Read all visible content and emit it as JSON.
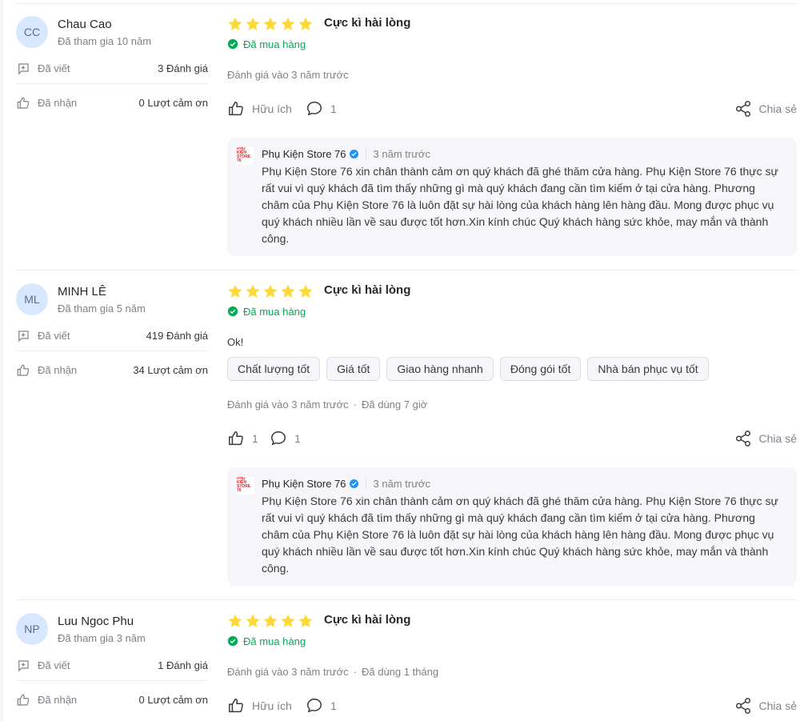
{
  "colors": {
    "star": "#fdd836",
    "bought": "#00ab56",
    "verified": "#1a94ff",
    "reply_bg": "#f5f5fa"
  },
  "reviews": [
    {
      "initials": "CC",
      "name": "Chau Cao",
      "joined": "Đã tham gia 10 năm",
      "written_label": "Đã viết",
      "written_value": "3 Đánh giá",
      "received_label": "Đã nhận",
      "received_value": "0 Lượt cảm ơn",
      "stars": 5,
      "rating_text": "Cực kì hài lòng",
      "bought": "Đã mua hàng",
      "text": "",
      "tags": [],
      "date": "Đánh giá vào 3 năm trước",
      "used": "",
      "like_label": "Hữu ích",
      "comment_count": "1",
      "share_label": "Chia sẻ",
      "reply": {
        "shop": "Phụ Kiện Store 76",
        "time": "3 năm trước",
        "text": "Phụ Kiện Store 76 xin chân thành cảm ơn quý khách đã ghé thăm cửa hàng. Phụ Kiện Store 76 thực sự rất vui vì quý khách đã tìm thấy những gì mà quý khách đang cần tìm kiếm ở tại cửa hàng. Phương châm của Phụ Kiện Store 76 là luôn đặt sự hài lòng của khách hàng lên hàng đầu. Mong được phục vụ quý khách nhiều lần về sau được tốt hơn.Xin kính chúc Quý khách hàng sức khỏe, may mắn và thành công."
      }
    },
    {
      "initials": "ML",
      "name": "MINH LÊ",
      "joined": "Đã tham gia 5 năm",
      "written_label": "Đã viết",
      "written_value": "419 Đánh giá",
      "received_label": "Đã nhận",
      "received_value": "34 Lượt cảm ơn",
      "stars": 5,
      "rating_text": "Cực kì hài lòng",
      "bought": "Đã mua hàng",
      "text": "Ok!",
      "tags": [
        "Chất lượng tốt",
        "Giá tốt",
        "Giao hàng nhanh",
        "Đóng gói tốt",
        "Nhà bán phục vụ tốt"
      ],
      "date": "Đánh giá vào 3 năm trước",
      "used": "Đã dùng 7 giờ",
      "like_label": "1",
      "comment_count": "1",
      "share_label": "Chia sẻ",
      "reply": {
        "shop": "Phụ Kiện Store 76",
        "time": "3 năm trước",
        "text": "Phụ Kiện Store 76 xin chân thành cảm ơn quý khách đã ghé thăm cửa hàng. Phụ Kiện Store 76 thực sự rất vui vì quý khách đã tìm thấy những gì mà quý khách đang cần tìm kiếm ở tại cửa hàng. Phương châm của Phụ Kiện Store 76 là luôn đặt sự hài lòng của khách hàng lên hàng đầu. Mong được phục vụ quý khách nhiều lần về sau được tốt hơn.Xin kính chúc Quý khách hàng sức khỏe, may mắn và thành công."
      }
    },
    {
      "initials": "NP",
      "name": "Luu Ngoc Phu",
      "joined": "Đã tham gia 3 năm",
      "written_label": "Đã viết",
      "written_value": "1 Đánh giá",
      "received_label": "Đã nhận",
      "received_value": "0 Lượt cảm ơn",
      "stars": 5,
      "rating_text": "Cực kì hài lòng",
      "bought": "Đã mua hàng",
      "text": "",
      "tags": [],
      "date": "Đánh giá vào 3 năm trước",
      "used": "Đã dùng 1 tháng",
      "like_label": "Hữu ích",
      "comment_count": "1",
      "share_label": "Chia sẻ",
      "reply": null
    }
  ]
}
